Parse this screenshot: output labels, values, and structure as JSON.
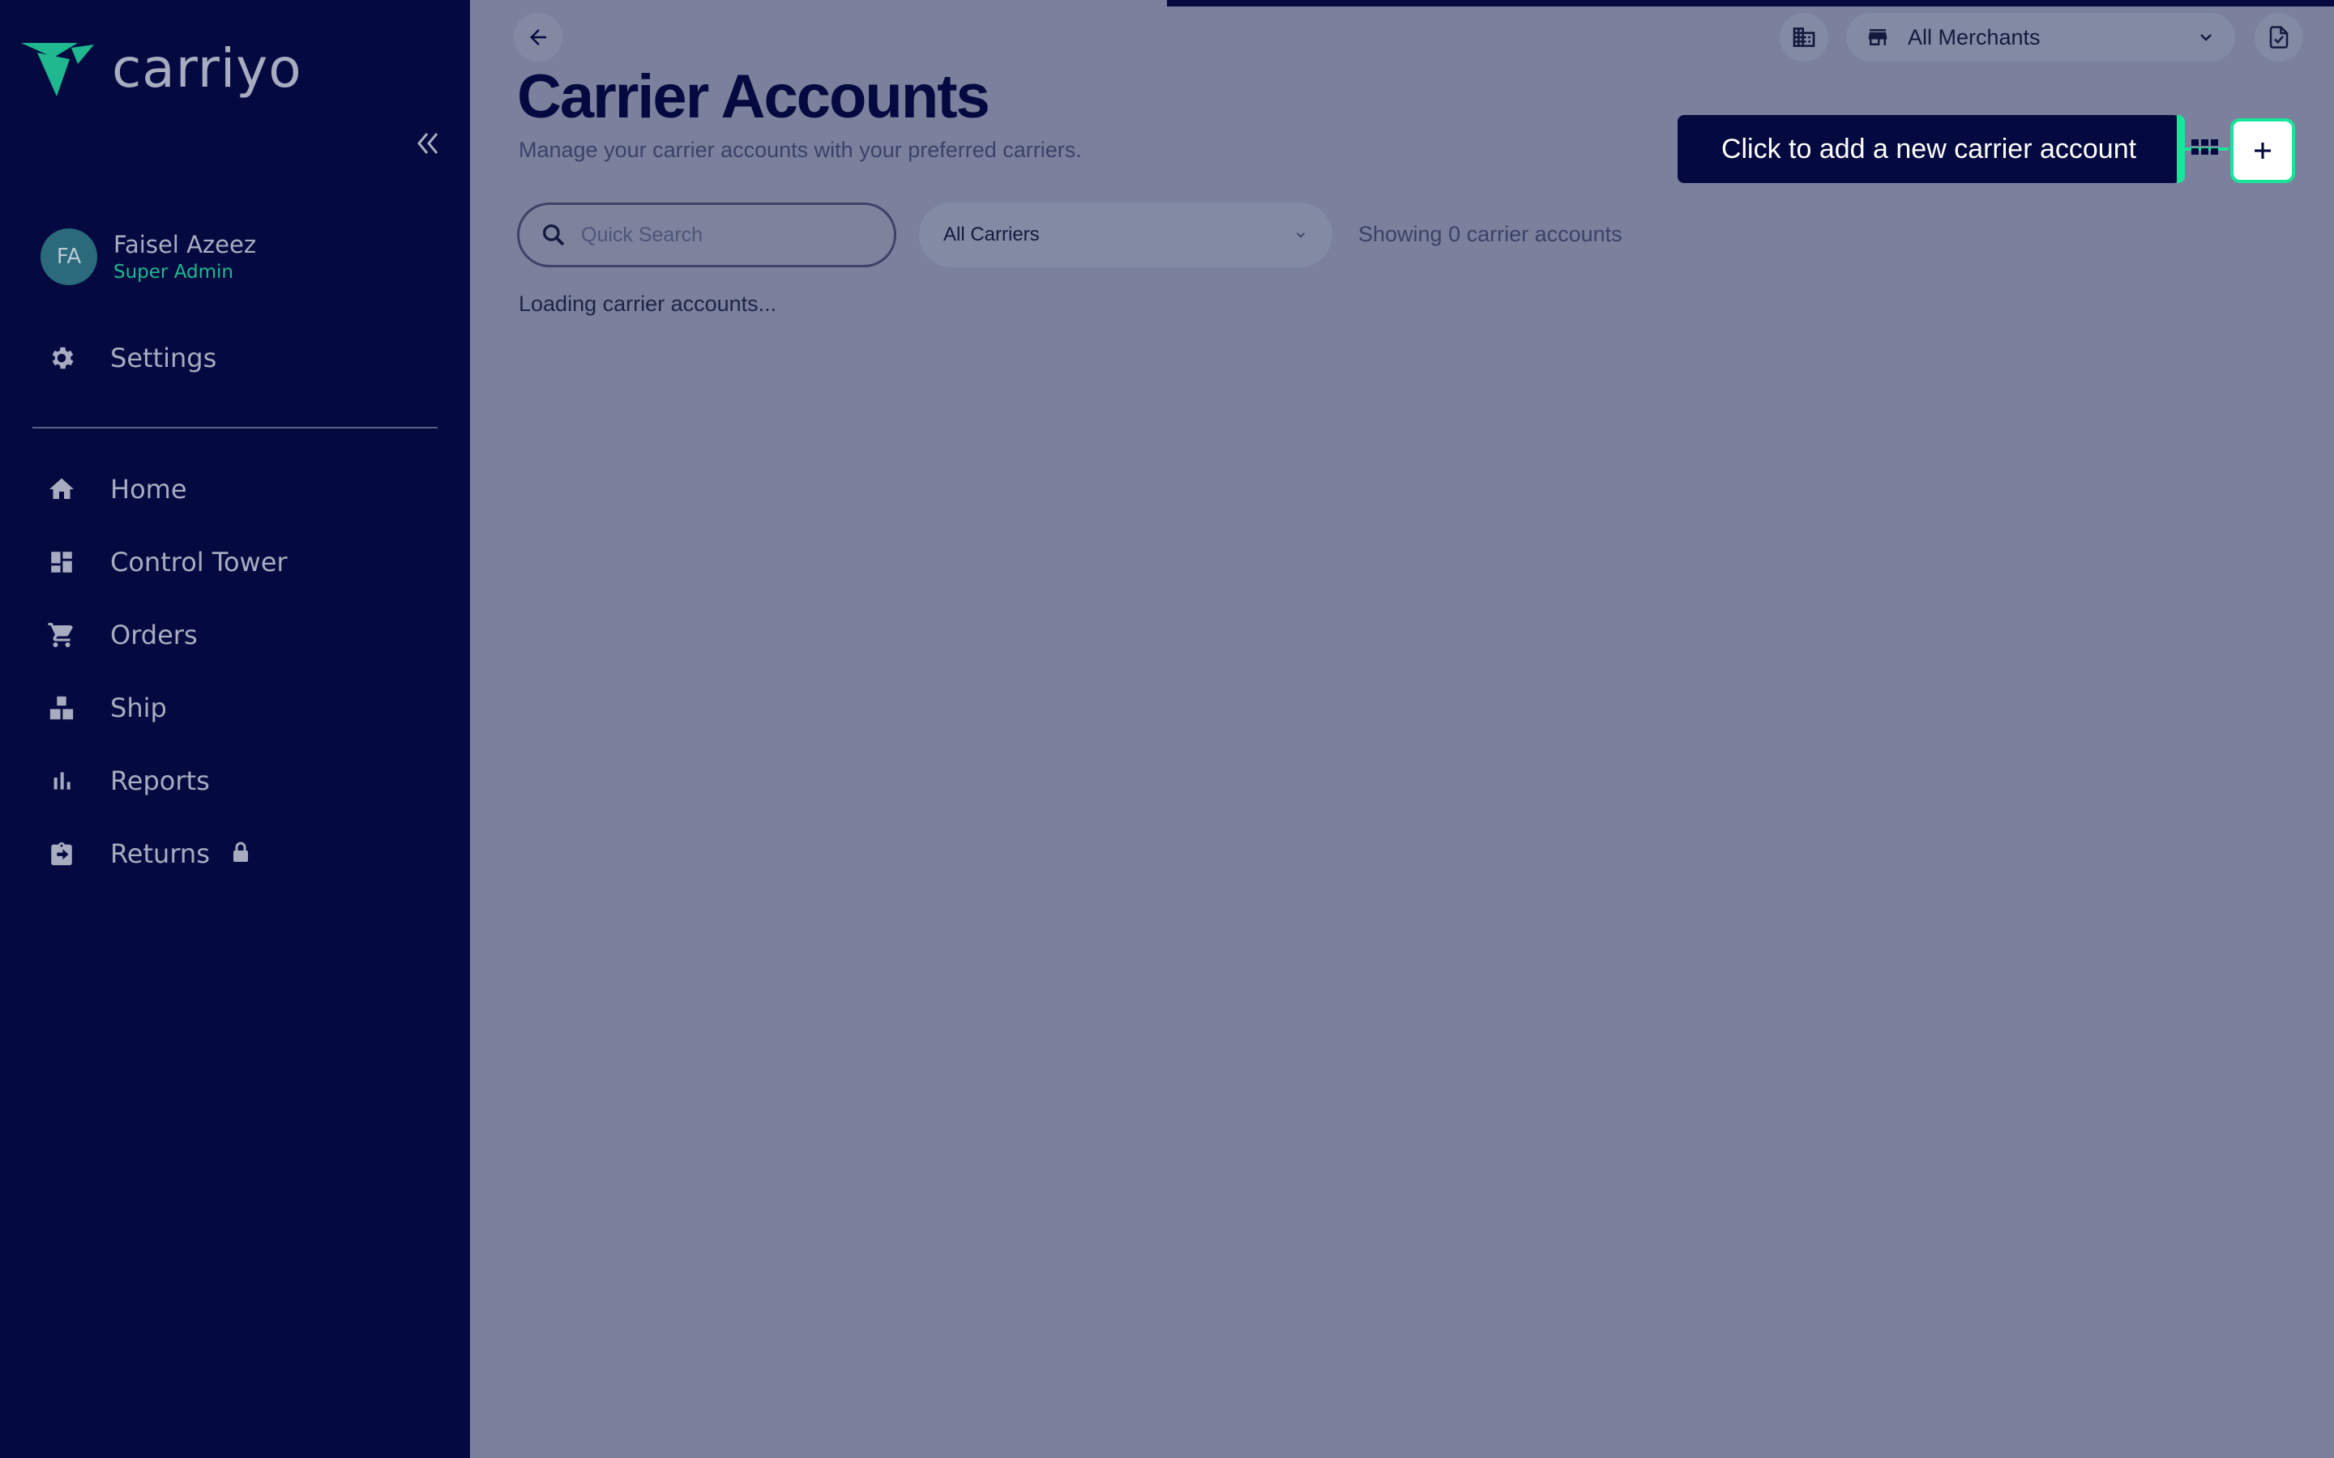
{
  "app": {
    "logo_text": "carriyo"
  },
  "user": {
    "initials": "FA",
    "name": "Faisel Azeez",
    "role": "Super Admin"
  },
  "sidebar": {
    "settings_label": "Settings",
    "items": [
      {
        "label": "Home",
        "icon": "home-icon"
      },
      {
        "label": "Control Tower",
        "icon": "dashboard-icon"
      },
      {
        "label": "Orders",
        "icon": "cart-icon"
      },
      {
        "label": "Ship",
        "icon": "ship-icon"
      },
      {
        "label": "Reports",
        "icon": "bar-chart-icon"
      },
      {
        "label": "Returns",
        "icon": "returns-icon",
        "locked": true
      }
    ]
  },
  "header": {
    "merchant_select": "All Merchants"
  },
  "page": {
    "title": "Carrier Accounts",
    "subtitle": "Manage your carrier accounts with your preferred carriers.",
    "search_placeholder": "Quick Search",
    "carrier_filter": "All Carriers",
    "count_text": "Showing 0 carrier accounts",
    "loading_text": "Loading carrier accounts..."
  },
  "tooltip": {
    "text": "Click to add a new carrier account"
  },
  "colors": {
    "sidebar": "#040a40",
    "accent": "#19e59a",
    "overlay": "#7b809c"
  }
}
